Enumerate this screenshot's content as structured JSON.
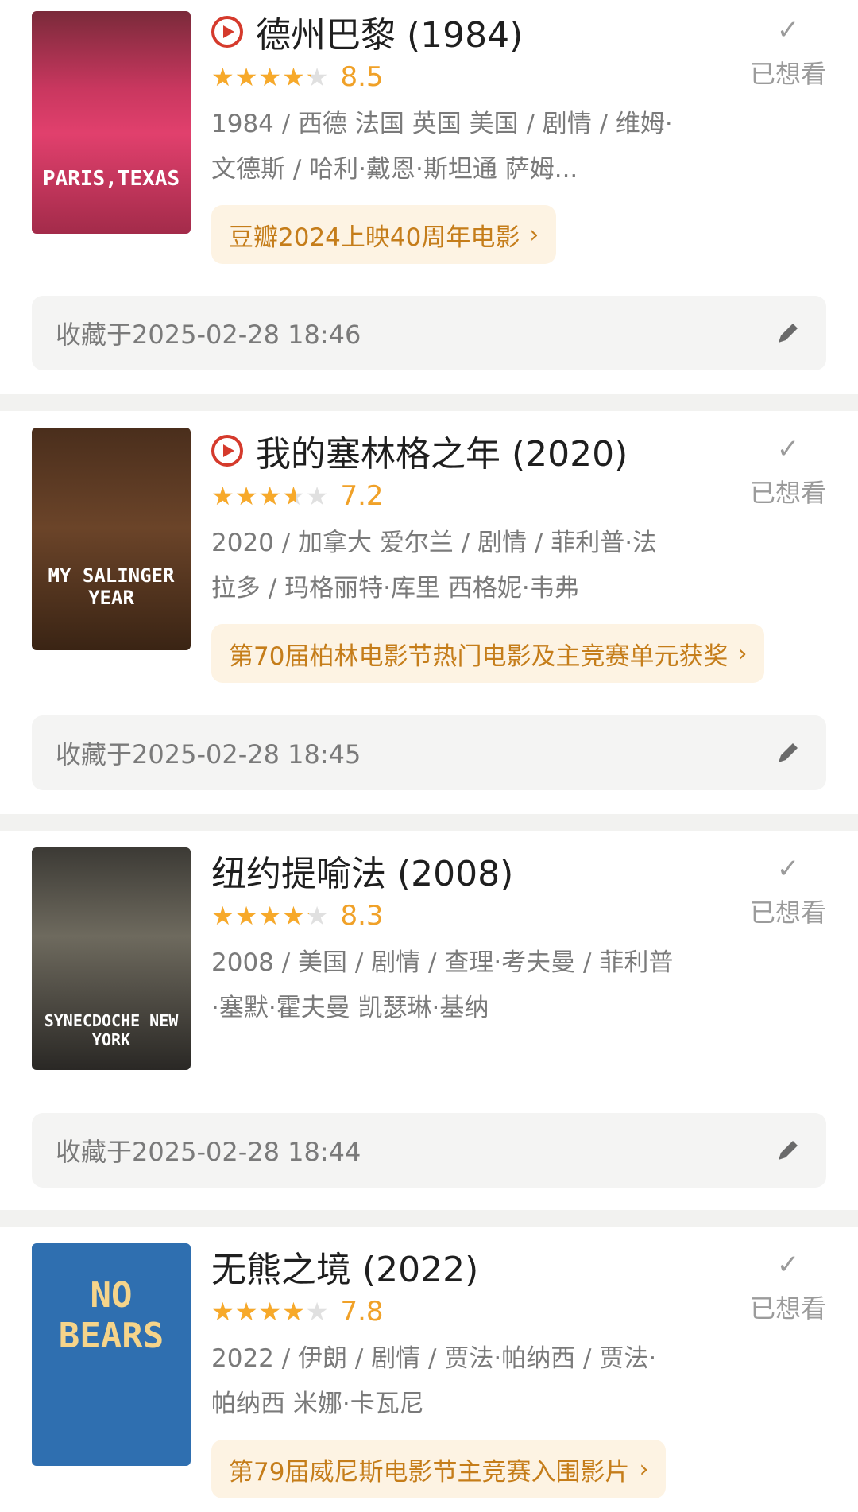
{
  "items": [
    {
      "title": "德州巴黎 (1984)",
      "rating": 8.5,
      "score_text": "8.5",
      "meta": "1984 / 西德 法国 英国 美国 / 剧情 / 维姆·文德斯 / 哈利·戴恩·斯坦通 萨姆...",
      "tag": "豆瓣2024上映40周年电影",
      "want_label": "已想看",
      "saved": "收藏于2025-02-28 18:46",
      "poster_text": "PARIS,TEXAS"
    },
    {
      "title": "我的塞林格之年 (2020)",
      "rating": 7.2,
      "score_text": "7.2",
      "meta": "2020 / 加拿大 爱尔兰 / 剧情 / 菲利普·法拉多 / 玛格丽特·库里 西格妮·韦弗",
      "tag": "第70届柏林电影节热门电影及主竞赛单元获奖",
      "want_label": "已想看",
      "saved": "收藏于2025-02-28 18:45",
      "poster_text": "MY SALINGER YEAR"
    },
    {
      "title": "纽约提喻法 (2008)",
      "rating": 8.3,
      "score_text": "8.3",
      "meta": "2008 / 美国 / 剧情 / 查理·考夫曼 / 菲利普·塞默·霍夫曼 凯瑟琳·基纳",
      "want_label": "已想看",
      "saved": "收藏于2025-02-28 18:44",
      "poster_text": "SYNECDOCHE NEW YORK"
    },
    {
      "title": "无熊之境 (2022)",
      "rating": 7.8,
      "score_text": "7.8",
      "meta": "2022 / 伊朗 / 剧情 / 贾法·帕纳西 / 贾法·帕纳西 米娜·卡瓦尼",
      "tag": "第79届威尼斯电影节主竞赛入围影片",
      "want_label": "已想看",
      "poster_text": "NO BEARS"
    }
  ],
  "colors": {
    "accent_orange": "#f0a128",
    "tag_text": "#c57d1a",
    "tag_bg": "#fdf3e3",
    "play_red": "#d53a2c"
  }
}
